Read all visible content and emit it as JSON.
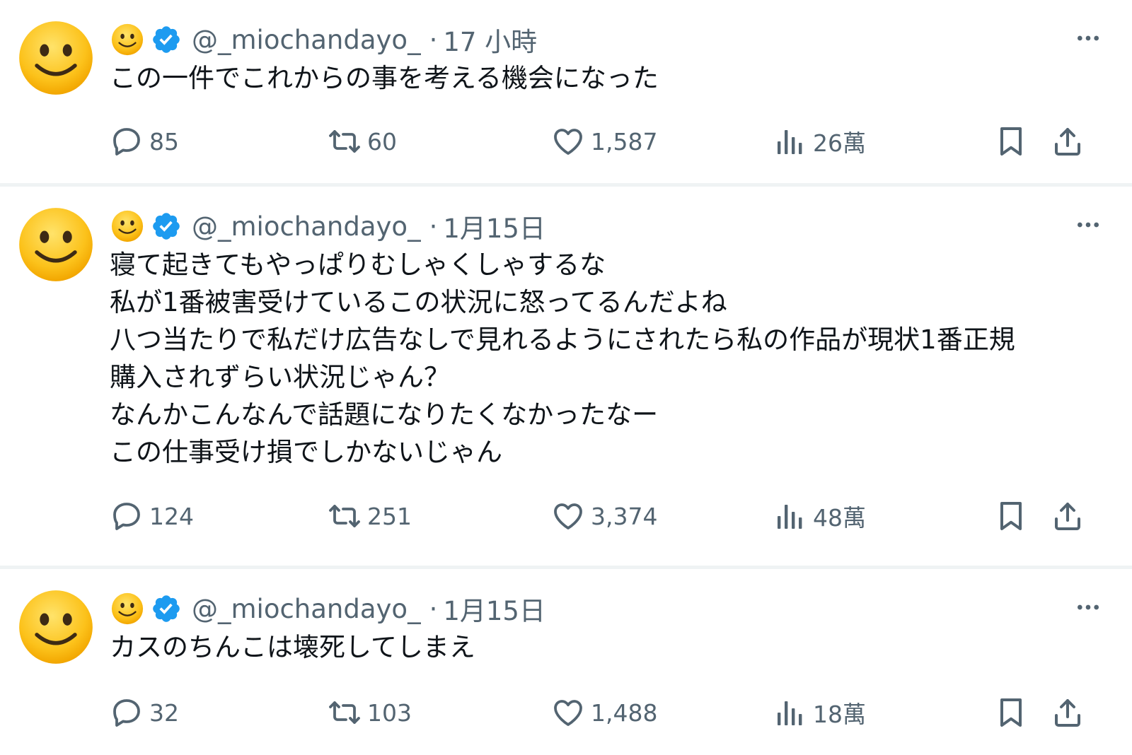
{
  "tweets": [
    {
      "handle": "@_miochandayo_",
      "separator": "·",
      "time": "17 小時",
      "lines": [
        "この一件でこれからの事を考える機会になった"
      ],
      "replies": "85",
      "retweets": "60",
      "likes": "1,587",
      "views": "26萬"
    },
    {
      "handle": "@_miochandayo_",
      "separator": "·",
      "time": "1月15日",
      "lines": [
        "寝て起きてもやっぱりむしゃくしゃするな",
        "私が1番被害受けているこの状況に怒ってるんだよね",
        "八つ当たりで私だけ広告なしで見れるようにされたら私の作品が現状1番正規",
        "購入されずらい状況じゃん？",
        "なんかこんなんで話題になりたくなかったなー",
        "この仕事受け損でしかないじゃん"
      ],
      "replies": "124",
      "retweets": "251",
      "likes": "3,374",
      "views": "48萬"
    },
    {
      "handle": "@_miochandayo_",
      "separator": "·",
      "time": "1月15日",
      "lines": [
        "カスのちんこは壊死してしまえ"
      ],
      "replies": "32",
      "retweets": "103",
      "likes": "1,488",
      "views": "18萬"
    }
  ],
  "icons": {
    "avatar": "smiling-face-emoji",
    "name": "smiling-face-emoji",
    "verified": "verified-badge-icon",
    "more": "more-dots-icon",
    "reply": "reply-icon",
    "retweet": "retweet-icon",
    "like": "heart-icon",
    "views": "views-icon",
    "bookmark": "bookmark-icon",
    "share": "share-icon"
  },
  "colors": {
    "text": "#0f1419",
    "muted": "#536471",
    "verified": "#1d9bf0",
    "divider": "#eff3f4",
    "emoji_face": "#fcc21b"
  }
}
